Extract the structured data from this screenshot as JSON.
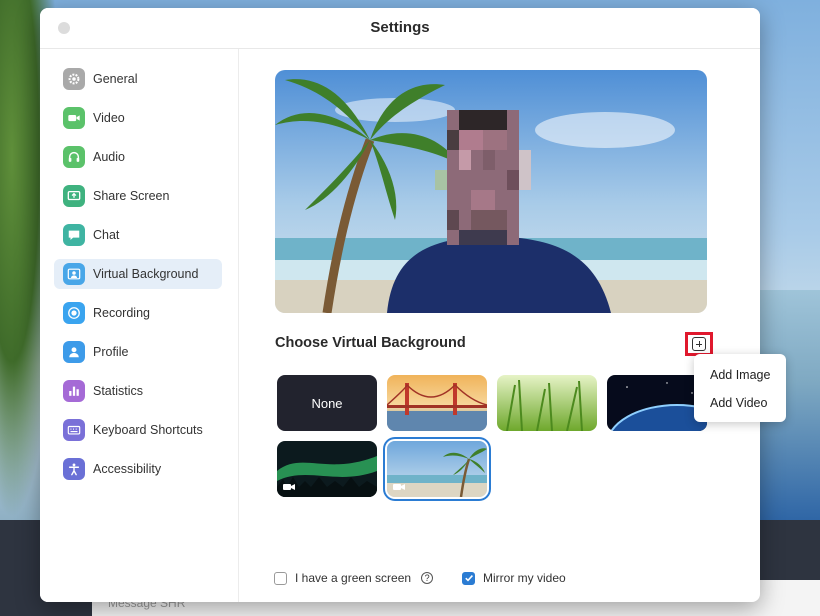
{
  "window": {
    "title": "Settings"
  },
  "backdrop": {
    "message_placeholder": "Message SHR"
  },
  "sidebar": {
    "items": [
      {
        "label": "General",
        "icon": "gear-icon",
        "color": "#a9a9a9"
      },
      {
        "label": "Video",
        "icon": "video-camera-icon",
        "color": "#5bc26a"
      },
      {
        "label": "Audio",
        "icon": "headphones-icon",
        "color": "#5bc26a"
      },
      {
        "label": "Share Screen",
        "icon": "share-screen-icon",
        "color": "#3fb27f"
      },
      {
        "label": "Chat",
        "icon": "chat-bubble-icon",
        "color": "#3fb4a2"
      },
      {
        "label": "Virtual Background",
        "icon": "person-portrait-icon",
        "color": "#48a6e8",
        "active": true
      },
      {
        "label": "Recording",
        "icon": "record-icon",
        "color": "#3aa4ef"
      },
      {
        "label": "Profile",
        "icon": "user-icon",
        "color": "#3d9be9"
      },
      {
        "label": "Statistics",
        "icon": "bar-chart-icon",
        "color": "#a56ad6"
      },
      {
        "label": "Keyboard Shortcuts",
        "icon": "keyboard-icon",
        "color": "#7a70d8"
      },
      {
        "label": "Accessibility",
        "icon": "accessibility-icon",
        "color": "#6a70d6"
      }
    ]
  },
  "main": {
    "section_title": "Choose Virtual Background",
    "add_button_icon": "plus-square-icon",
    "thumbnails": [
      {
        "label": "None",
        "kind": "none"
      },
      {
        "label": "",
        "kind": "golden-gate"
      },
      {
        "label": "",
        "kind": "grass"
      },
      {
        "label": "",
        "kind": "earth"
      },
      {
        "label": "",
        "kind": "aurora",
        "video": true
      },
      {
        "label": "",
        "kind": "beach",
        "video": true,
        "selected": true
      }
    ],
    "add_menu": {
      "items": [
        "Add Image",
        "Add Video"
      ]
    },
    "green_screen": {
      "label": "I have a green screen",
      "checked": false
    },
    "mirror": {
      "label": "Mirror my video",
      "checked": true
    },
    "help_icon": "question-circle-icon",
    "accent": "#2b7cd3"
  }
}
